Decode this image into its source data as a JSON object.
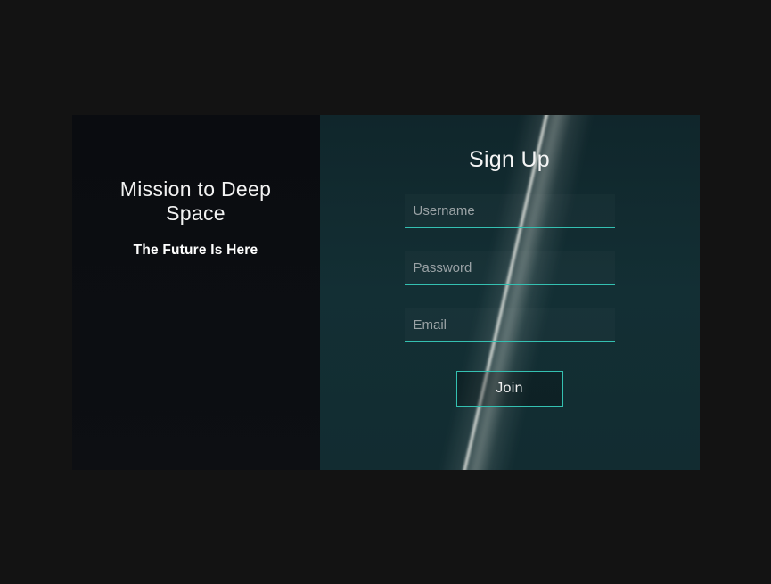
{
  "left": {
    "headline": "Mission to Deep Space",
    "subhead": "The Future Is Here"
  },
  "form": {
    "title": "Sign Up",
    "username_placeholder": "Username",
    "password_placeholder": "Password",
    "email_placeholder": "Email",
    "join_label": "Join"
  },
  "accent_color": "#34c0b1"
}
